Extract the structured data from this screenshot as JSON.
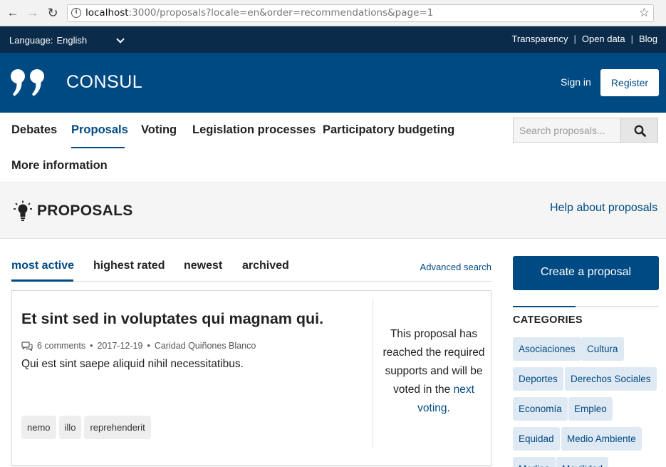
{
  "browser": {
    "url_host": "localhost",
    "url_rest": ":3000/proposals?locale=en&order=recommendations&page=1"
  },
  "top_bar": {
    "language_label": "Language:",
    "language_value": "English",
    "links": [
      "Transparency",
      "Open data",
      "Blog"
    ]
  },
  "header": {
    "brand": "CONSUL",
    "sign_in": "Sign in",
    "register": "Register"
  },
  "main_nav": {
    "items": [
      "Debates",
      "Proposals",
      "Voting",
      "Legislation processes",
      "Participatory budgeting",
      "More information"
    ],
    "active": "Proposals",
    "search_placeholder": "Search proposals..."
  },
  "page": {
    "title": "PROPOSALS",
    "help_link": "Help about proposals"
  },
  "order_tabs": {
    "items": [
      "most active",
      "highest rated",
      "newest",
      "archived"
    ],
    "active": "most active",
    "advanced_search": "Advanced search"
  },
  "proposal": {
    "title": "Et sint sed in voluptates qui magnam qui.",
    "comments": "6 comments",
    "date": "2017-12-19",
    "author": "Caridad Quiñones Blanco",
    "description": "Qui est sint saepe aliquid nihil necessitatibus.",
    "tags": [
      "nemo",
      "illo",
      "reprehenderit"
    ],
    "support_text": "This proposal has reached the required supports and will be voted in the",
    "support_link": "next voting",
    "support_end": "."
  },
  "sidebar": {
    "create_button": "Create a proposal",
    "categories_title": "CATEGORIES",
    "categories": [
      "Asociaciones",
      "Cultura",
      "Deportes",
      "Derechos Sociales",
      "Economía",
      "Empleo",
      "Equidad",
      "Medio Ambiente",
      "Medios",
      "Movilidad"
    ]
  },
  "colors": {
    "top_bar": "#0b2b4a",
    "header": "#004a83",
    "accent": "#004a83",
    "chip_bg": "#dfe9f4"
  }
}
